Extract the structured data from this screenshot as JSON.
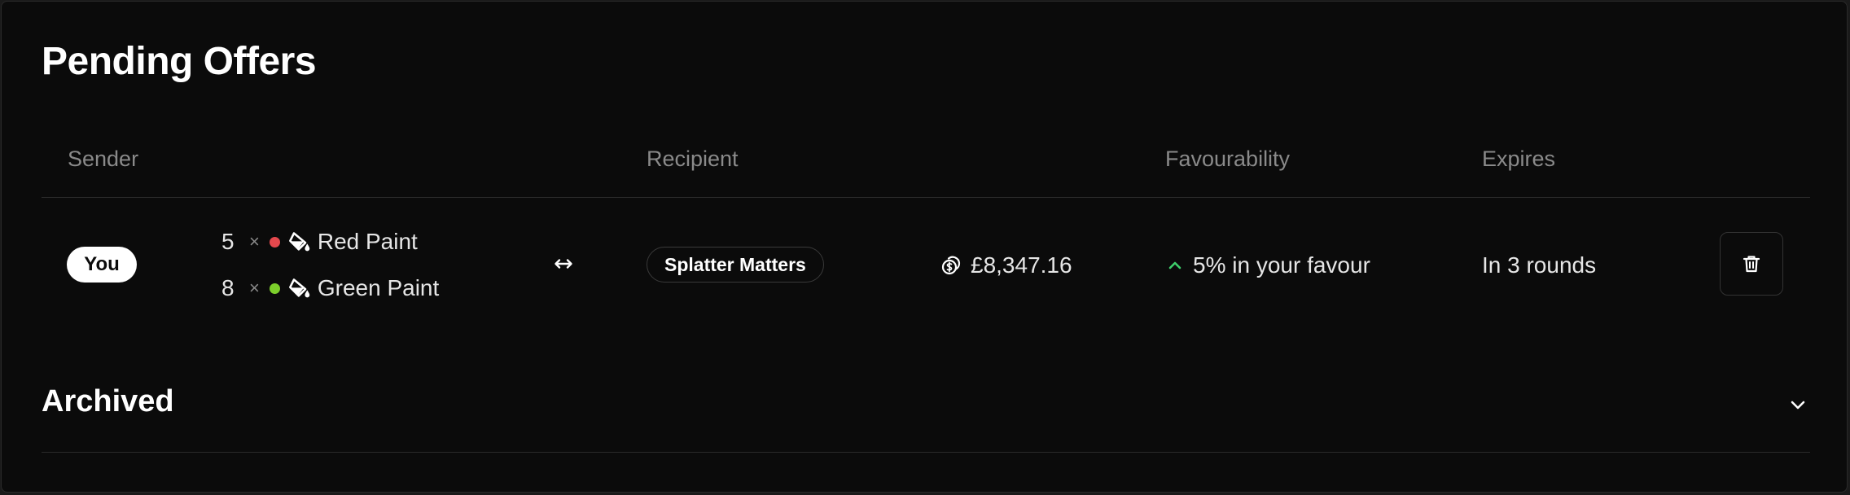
{
  "pending": {
    "title": "Pending Offers",
    "columns": {
      "sender": "Sender",
      "recipient": "Recipient",
      "favourability": "Favourability",
      "expires": "Expires"
    },
    "offers": [
      {
        "sender": "You",
        "items": [
          {
            "qty": "5",
            "times": "×",
            "name": "Red Paint",
            "color": "#e5484d",
            "icon": "paint-bucket-icon"
          },
          {
            "qty": "8",
            "times": "×",
            "name": "Green Paint",
            "color": "#7ccf2b",
            "icon": "paint-bucket-icon"
          }
        ],
        "swap_icon": "swap-horizontal-icon",
        "recipient": "Splatter Matters",
        "value": "£8,347.16",
        "value_icon": "coins-icon",
        "favourability": "5% in your favour",
        "favourability_icon": "chevron-up-icon",
        "favourability_color": "#3ecf6b",
        "expires": "In 3 rounds",
        "delete_icon": "trash-icon"
      }
    ]
  },
  "archived": {
    "title": "Archived",
    "toggle_icon": "chevron-down-icon"
  }
}
